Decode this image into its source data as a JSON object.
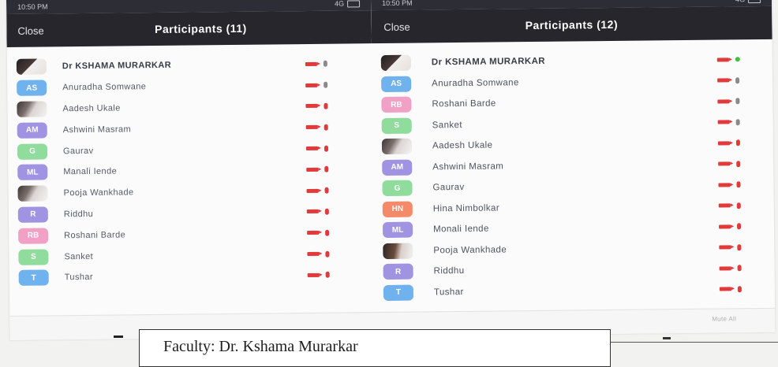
{
  "left_panel": {
    "status": {
      "time": "10:50 PM",
      "signal": "4G"
    },
    "header": {
      "close_label": "Close",
      "title": "Participants (11)"
    },
    "participants": [
      {
        "name": "Dr KSHAMA MURARKAR",
        "initials": "",
        "color": "#222226",
        "host": true,
        "mic": "grey"
      },
      {
        "name": "Anuradha Somwane",
        "initials": "AS",
        "color": "#6fb2ee",
        "mic": "grey"
      },
      {
        "name": "Aadesh Ukale",
        "initials": "",
        "color": "#444",
        "mic": "red"
      },
      {
        "name": "Ashwini Masram",
        "initials": "AM",
        "color": "#9f93e2",
        "mic": "red"
      },
      {
        "name": "Gaurav",
        "initials": "G",
        "color": "#8fdc9c",
        "mic": "red"
      },
      {
        "name": "Manali Iende",
        "initials": "ML",
        "color": "#9f93e2",
        "mic": "red"
      },
      {
        "name": "Pooja Wankhade",
        "initials": "",
        "color": "#555",
        "mic": "red"
      },
      {
        "name": "Riddhu",
        "initials": "R",
        "color": "#9f93e2",
        "mic": "red"
      },
      {
        "name": "Roshani Barde",
        "initials": "RB",
        "color": "#f1a0c6",
        "mic": "red"
      },
      {
        "name": "Sanket",
        "initials": "S",
        "color": "#8fdc9c",
        "mic": "red"
      },
      {
        "name": "Tushar",
        "initials": "T",
        "color": "#6fb2ee",
        "mic": "red"
      }
    ]
  },
  "right_panel": {
    "status": {
      "time": "10:50 PM",
      "signal": "4G"
    },
    "header": {
      "close_label": "Close",
      "title": "Participants (12)"
    },
    "participants": [
      {
        "name": "Dr KSHAMA MURARKAR",
        "initials": "",
        "color": "#222226",
        "host": true,
        "mic": "green"
      },
      {
        "name": "Anuradha Somwane",
        "initials": "AS",
        "color": "#6fb2ee",
        "mic": "grey"
      },
      {
        "name": "Roshani Barde",
        "initials": "RB",
        "color": "#f1a0c6",
        "mic": "grey"
      },
      {
        "name": "Sanket",
        "initials": "S",
        "color": "#8fdc9c",
        "mic": "grey"
      },
      {
        "name": "Aadesh Ukale",
        "initials": "",
        "color": "#444",
        "mic": "red"
      },
      {
        "name": "Ashwini Masram",
        "initials": "AM",
        "color": "#9f93e2",
        "mic": "red"
      },
      {
        "name": "Gaurav",
        "initials": "G",
        "color": "#8fdc9c",
        "mic": "red"
      },
      {
        "name": "Hina Nimbolkar",
        "initials": "HN",
        "color": "#f58a6a",
        "mic": "red"
      },
      {
        "name": "Monali Iende",
        "initials": "ML",
        "color": "#9f93e2",
        "mic": "red"
      },
      {
        "name": "Pooja Wankhade",
        "initials": "",
        "color": "#555",
        "mic": "red"
      },
      {
        "name": "Riddhu",
        "initials": "R",
        "color": "#9f93e2",
        "mic": "red"
      },
      {
        "name": "Tushar",
        "initials": "T",
        "color": "#6fb2ee",
        "mic": "red"
      }
    ]
  },
  "bottom": {
    "mute_all": "Mute All"
  },
  "caption": {
    "text": "Faculty: Dr. Kshama Murarkar"
  },
  "icons": {
    "video": "video-camera-icon",
    "mic": "microphone-icon"
  }
}
